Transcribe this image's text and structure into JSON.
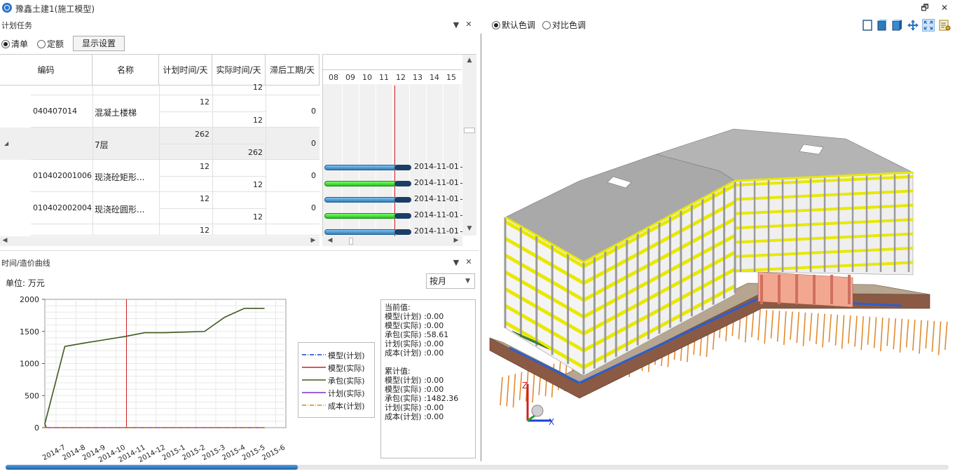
{
  "window": {
    "title": "豫鑫土建1(施工模型)",
    "restore_glyph": "🗗",
    "close_glyph": "✕"
  },
  "plan_panel": {
    "title": "计划任务",
    "pin_glyph": "▼",
    "close_glyph": "✕",
    "mode_options": [
      {
        "label": "清单",
        "selected": true
      },
      {
        "label": "定额",
        "selected": false
      }
    ],
    "display_settings_label": "显示设置",
    "columns": [
      "编码",
      "名称",
      "计划时间/天",
      "实际时间/天",
      "滞后工期/天"
    ],
    "rows": [
      {
        "code": "",
        "name": "",
        "plan": "",
        "actual": "12",
        "delay": "",
        "partial": true
      },
      {
        "code": "040407014",
        "name": "混凝土楼梯",
        "plan": "12",
        "actual": "12",
        "delay": "0"
      },
      {
        "code": "",
        "name": "7层",
        "plan": "262",
        "actual": "262",
        "delay": "0",
        "group": true
      },
      {
        "code": "010402001006",
        "name": "现浇砼矩形...",
        "plan": "12",
        "actual": "12",
        "delay": "0"
      },
      {
        "code": "010402002004",
        "name": "现浇砼圆形...",
        "plan": "12",
        "actual": "12",
        "delay": "0"
      },
      {
        "code": "",
        "name": "",
        "plan": "12",
        "actual": "",
        "delay": "",
        "partial": true
      }
    ],
    "expand_glyph": "◢",
    "gantt": {
      "days": [
        "08",
        "09",
        "10",
        "11",
        "12",
        "13",
        "14",
        "15"
      ],
      "bars": [
        {
          "type": "blue",
          "date": "2014-11-01"
        },
        {
          "type": "green",
          "date": "2014-11-01"
        },
        {
          "type": "blue",
          "date": "2014-11-01"
        },
        {
          "type": "green",
          "date": "2014-11-01"
        },
        {
          "type": "blue",
          "date": "2014-11-01"
        }
      ]
    }
  },
  "curve_panel": {
    "title": "时间/造价曲线",
    "pin_glyph": "▼",
    "close_glyph": "✕",
    "unit_label": "单位: 万元",
    "period_select": "按月",
    "legend": [
      {
        "name": "模型(计划)",
        "color": "#1f3fbf",
        "dash": "dashdot"
      },
      {
        "name": "模型(实际)",
        "color": "#cc2020",
        "dash": "solid"
      },
      {
        "name": "承包(实际)",
        "color": "#3d5a1e",
        "dash": "solid"
      },
      {
        "name": "计划(实际)",
        "color": "#7a2fc8",
        "dash": "solid"
      },
      {
        "name": "成本(计划)",
        "color": "#d58a00",
        "dash": "dashdot"
      }
    ],
    "info": {
      "current_header": "当前值:",
      "current_lines": [
        "模型(计划) :0.00",
        "模型(实际) :0.00",
        "承包(实际) :58.61",
        "计划(实际) :0.00",
        "成本(计划) :0.00"
      ],
      "cumulative_header": "累计值:",
      "cumulative_lines": [
        "模型(计划) :0.00",
        "模型(实际) :0.00",
        "承包(实际) :1482.36",
        "计划(实际) :0.00",
        "成本(计划) :0.00"
      ]
    }
  },
  "chart_data": {
    "type": "line",
    "categories": [
      "2014-7",
      "2014-8",
      "2014-9",
      "2014-10",
      "2014-11",
      "2014-12",
      "2015-1",
      "2015-2",
      "2015-3",
      "2015-4",
      "2015-5",
      "2015-6"
    ],
    "ylim": [
      0,
      2000
    ],
    "yticks": [
      "0",
      "500",
      "1000",
      "1500",
      "2000"
    ],
    "grid": true,
    "legend_position": "right",
    "current_marker": "2014-10",
    "series": [
      {
        "name": "模型(计划)",
        "color": "#1f3fbf",
        "values": [
          0,
          0,
          0,
          0,
          0,
          0,
          0,
          0,
          0,
          0,
          0,
          0
        ]
      },
      {
        "name": "模型(实际)",
        "color": "#cc2020",
        "values": [
          0,
          0,
          0,
          0,
          0,
          0,
          0,
          0,
          0,
          0,
          0,
          0
        ]
      },
      {
        "name": "承包(实际)",
        "color": "#3d5a1e",
        "x": [
          -0.9,
          0,
          1,
          2,
          3,
          4,
          5,
          6,
          7,
          8,
          9,
          10,
          11
        ],
        "values": [
          0,
          60,
          1265,
          1320,
          1370,
          1420,
          1480,
          1480,
          1490,
          1500,
          1720,
          1860,
          1860
        ]
      },
      {
        "name": "计划(实际)",
        "color": "#7a2fc8",
        "values": [
          0,
          0,
          0,
          0,
          0,
          0,
          0,
          0,
          0,
          0,
          0,
          0
        ]
      },
      {
        "name": "成本(计划)",
        "color": "#d58a00",
        "values": [
          0,
          0,
          0,
          0,
          0,
          0,
          0,
          0,
          0,
          0,
          0,
          0
        ]
      }
    ]
  },
  "viewport": {
    "color_options": [
      {
        "label": "默认色调",
        "selected": true
      },
      {
        "label": "对比色调",
        "selected": false
      }
    ],
    "toolbar_icons": [
      "front-view-icon",
      "side-view-icon",
      "iso-view-icon",
      "pan-icon",
      "zoom-extents-icon",
      "settings-list-icon"
    ],
    "axis_x": "X",
    "axis_z": "Z",
    "colors": {
      "slab": "#a9a9a9",
      "beam": "#e8e800",
      "column": "#d8d8d8",
      "pile": "#e08a30",
      "foundation": "#8a5a44"
    }
  },
  "timeline": {
    "progress": 0.31
  }
}
